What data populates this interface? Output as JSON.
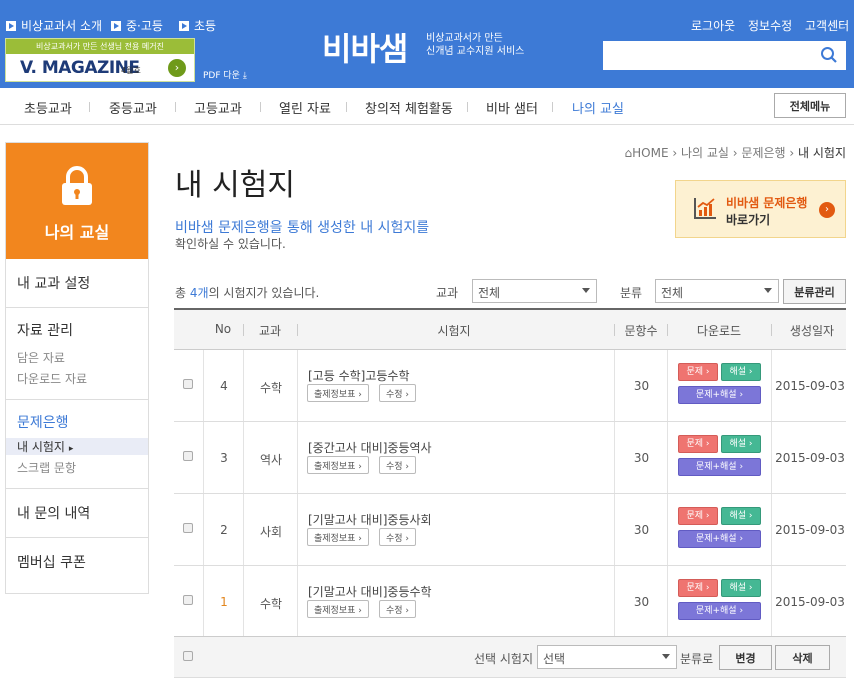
{
  "topbar": {
    "links_left": [
      "비상교과서 소개",
      "중·고등",
      "초등"
    ],
    "banner": {
      "top": "비상교과서가 만든 선생님 전용 메거진",
      "title": "V. MAGAZINE",
      "month": "4월호"
    },
    "pdf_download": "PDF 다운",
    "logo": {
      "part1": "비",
      "part2": "바샘"
    },
    "tagline": [
      "비상교과서가 만든",
      "신개념 교수지원 서비스"
    ],
    "links_right": [
      "로그아웃",
      "정보수정",
      "고객센터"
    ],
    "search_placeholder": ""
  },
  "nav": {
    "items": [
      "초등교과",
      "중등교과",
      "고등교과",
      "열린 자료",
      "창의적 체험활동",
      "비바 샘터",
      "나의 교실"
    ],
    "full_menu": "전체메뉴"
  },
  "sidebar": {
    "header": "나의 교실",
    "groups": [
      {
        "title": "내 교과 설정",
        "subs": []
      },
      {
        "title": "자료 관리",
        "subs": [
          "담은 자료",
          "다운로드 자료"
        ]
      },
      {
        "title": "문제은행",
        "subs": [
          "내 시험지",
          "스크랩 문항"
        ]
      },
      {
        "title": "내 문의 내역",
        "subs": []
      },
      {
        "title": "멤버십 쿠폰",
        "subs": []
      }
    ]
  },
  "breadcrumb": [
    "HOME",
    "나의 교실",
    "문제은행",
    "내 시험지"
  ],
  "page": {
    "title": "내 시험지",
    "desc_highlight": "비바샘 문제은행을 통해 생성한 내 시험지를",
    "desc_rest": "확인하실 수 있습니다."
  },
  "promo": {
    "line1": "비바샘 문제은행",
    "line2": "바로가기"
  },
  "filter": {
    "count_prefix": "총",
    "count": "4개",
    "count_suffix": "의 시험지가 있습니다.",
    "subject_label": "교과",
    "subject_value": "전체",
    "category_label": "분류",
    "category_value": "전체",
    "manage_button": "분류관리"
  },
  "table": {
    "columns": [
      "No",
      "교과",
      "시험지",
      "문항수",
      "다운로드",
      "생성일자"
    ],
    "rows": [
      {
        "no": "4",
        "subject": "수학",
        "title": "[고등 수학]고등수학",
        "count": "30",
        "date": "2015-09-03"
      },
      {
        "no": "3",
        "subject": "역사",
        "title": "[중간고사 대비]중등역사",
        "count": "30",
        "date": "2015-09-03"
      },
      {
        "no": "2",
        "subject": "사회",
        "title": "[기말고사 대비]중등사회",
        "count": "30",
        "date": "2015-09-03"
      },
      {
        "no": "1",
        "subject": "수학",
        "title": "[기말고사 대비]중등수학",
        "count": "30",
        "date": "2015-09-03"
      }
    ],
    "btn_info": "출제정보표",
    "btn_edit": "수정",
    "btn_question": "문제",
    "btn_answer": "해설",
    "btn_both": "문제+해설"
  },
  "footer": {
    "select_label": "선택 시험지",
    "select_value": "선택",
    "category_label": "분류로",
    "change_button": "변경",
    "delete_button": "삭제"
  },
  "colors": {
    "brand_blue": "#3d7ad6",
    "orange": "#f2861e",
    "promo_orange": "#e25a11"
  }
}
